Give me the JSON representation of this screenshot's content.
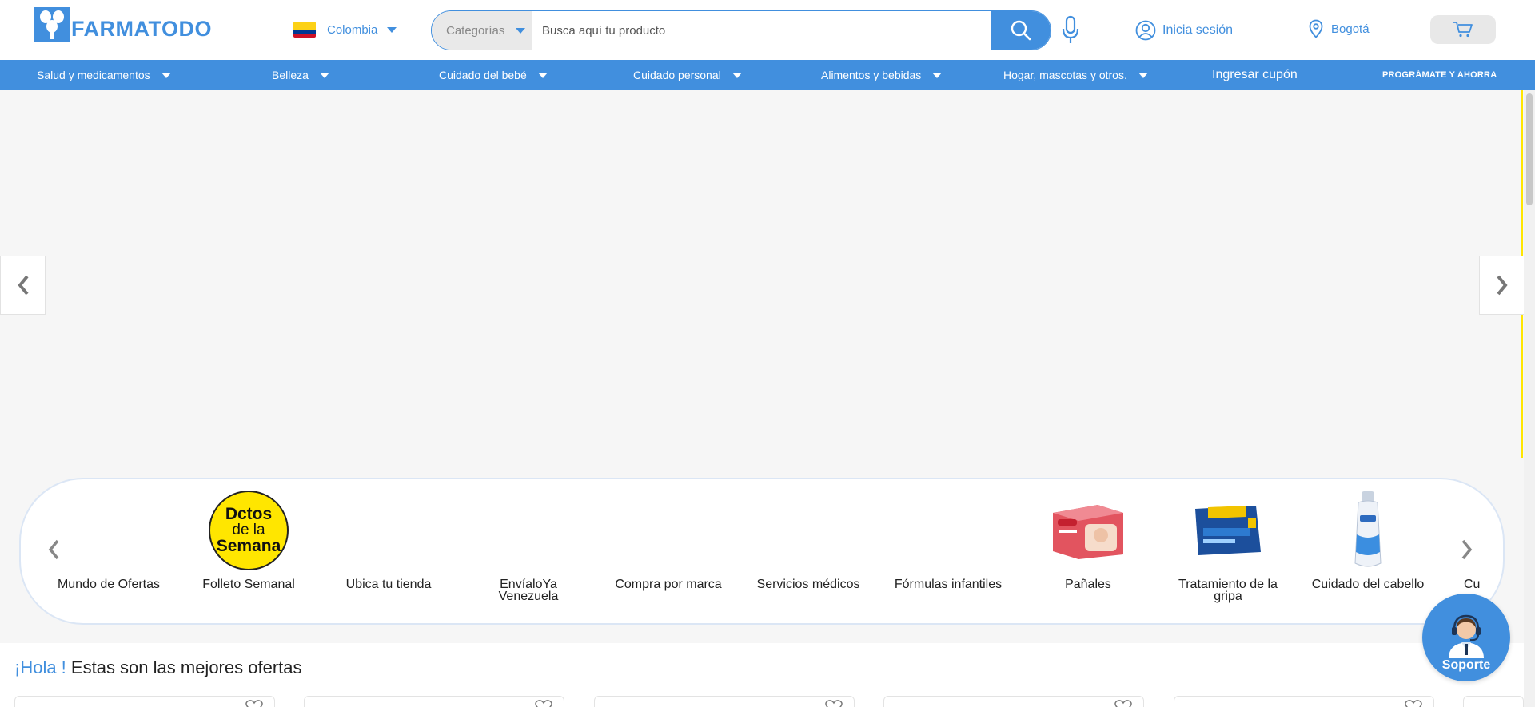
{
  "header": {
    "brand": "FARMATODO",
    "country": "Colombia",
    "search": {
      "category": "Categorías",
      "placeholder": "Busca aquí tu producto"
    },
    "login_label": "Inicia sesión",
    "city": "Bogotá"
  },
  "nav": {
    "items": [
      {
        "label": "Salud y medicamentos"
      },
      {
        "label": "Belleza"
      },
      {
        "label": "Cuidado del bebé"
      },
      {
        "label": "Cuidado personal"
      },
      {
        "label": "Alimentos y bebidas"
      },
      {
        "label": "Hogar, mascotas y otros."
      }
    ],
    "coupon": "Ingresar cupón",
    "programate": "PROGRÁMATE Y AHORRA"
  },
  "quick_categories": [
    {
      "label": "Mundo de Ofertas"
    },
    {
      "label": "Folleto Semanal",
      "badge": [
        "Dctos",
        "de la",
        "Semana"
      ]
    },
    {
      "label": "Ubica tu tienda"
    },
    {
      "label": "EnvíaloYa Venezuela"
    },
    {
      "label": "Compra por marca"
    },
    {
      "label": "Servicios médicos"
    },
    {
      "label": "Fórmulas infantiles"
    },
    {
      "label": "Pañales"
    },
    {
      "label": "Tratamiento de la gripa"
    },
    {
      "label": "Cuidado del cabello"
    },
    {
      "label": "Cu"
    }
  ],
  "offers": {
    "greeting": "¡Hola !",
    "title": "Estas son las mejores ofertas"
  },
  "support": {
    "label": "Soporte"
  },
  "colors": {
    "brand_blue": "#418fde",
    "badge_yellow": "#ffe600"
  }
}
